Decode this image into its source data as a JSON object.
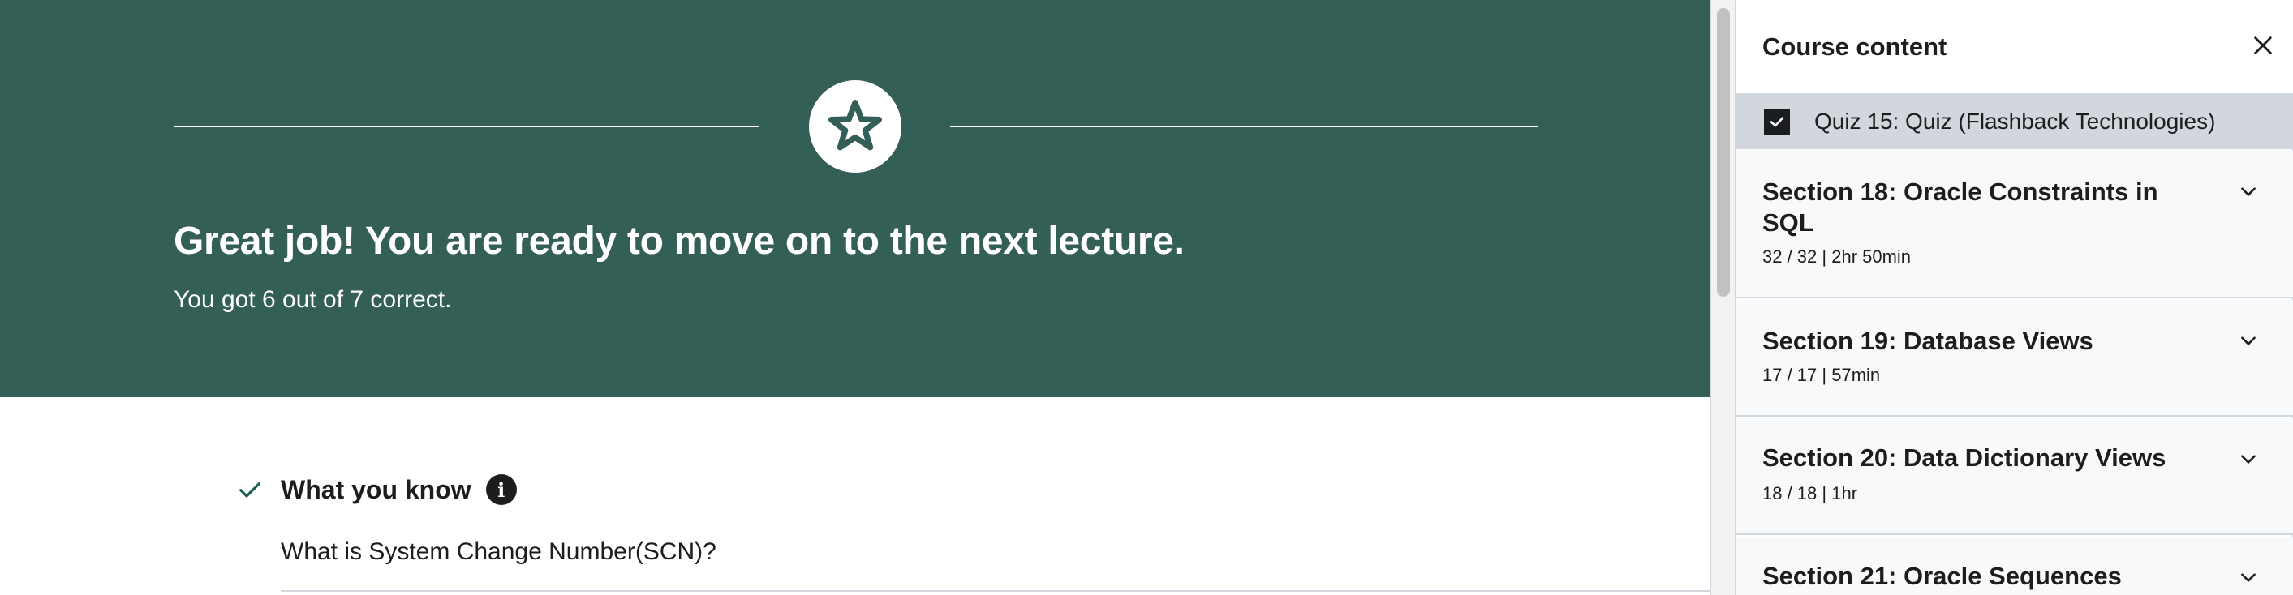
{
  "result": {
    "title": "Great job! You are ready to move on to the next lecture.",
    "subtitle": "You got 6 out of 7 correct."
  },
  "knowledge": {
    "heading": "What you know",
    "question": "What is System Change Number(SCN)?"
  },
  "sidebar": {
    "title": "Course content",
    "current_item": {
      "label": "Quiz 15: Quiz (Flashback Technologies)",
      "checked": true
    },
    "sections": [
      {
        "title": "Section 18: Oracle Constraints in SQL",
        "meta": "32 / 32 | 2hr 50min"
      },
      {
        "title": "Section 19: Database Views",
        "meta": "17 / 17 | 57min"
      },
      {
        "title": "Section 20: Data Dictionary Views",
        "meta": "18 / 18 | 1hr"
      },
      {
        "title": "Section 21: Oracle Sequences",
        "meta": ""
      }
    ]
  },
  "colors": {
    "hero_bg": "#335f57",
    "accent_check": "#1e6055",
    "text": "#1c1d1f",
    "section_bg": "#f7f9fa",
    "border": "#d1d7dc"
  },
  "icons": {
    "badge": "star-icon",
    "know": "check-icon",
    "info": "info-icon",
    "close": "close-icon",
    "expand": "chevron-down-icon",
    "checkbox": "checkbox-checked-icon"
  }
}
